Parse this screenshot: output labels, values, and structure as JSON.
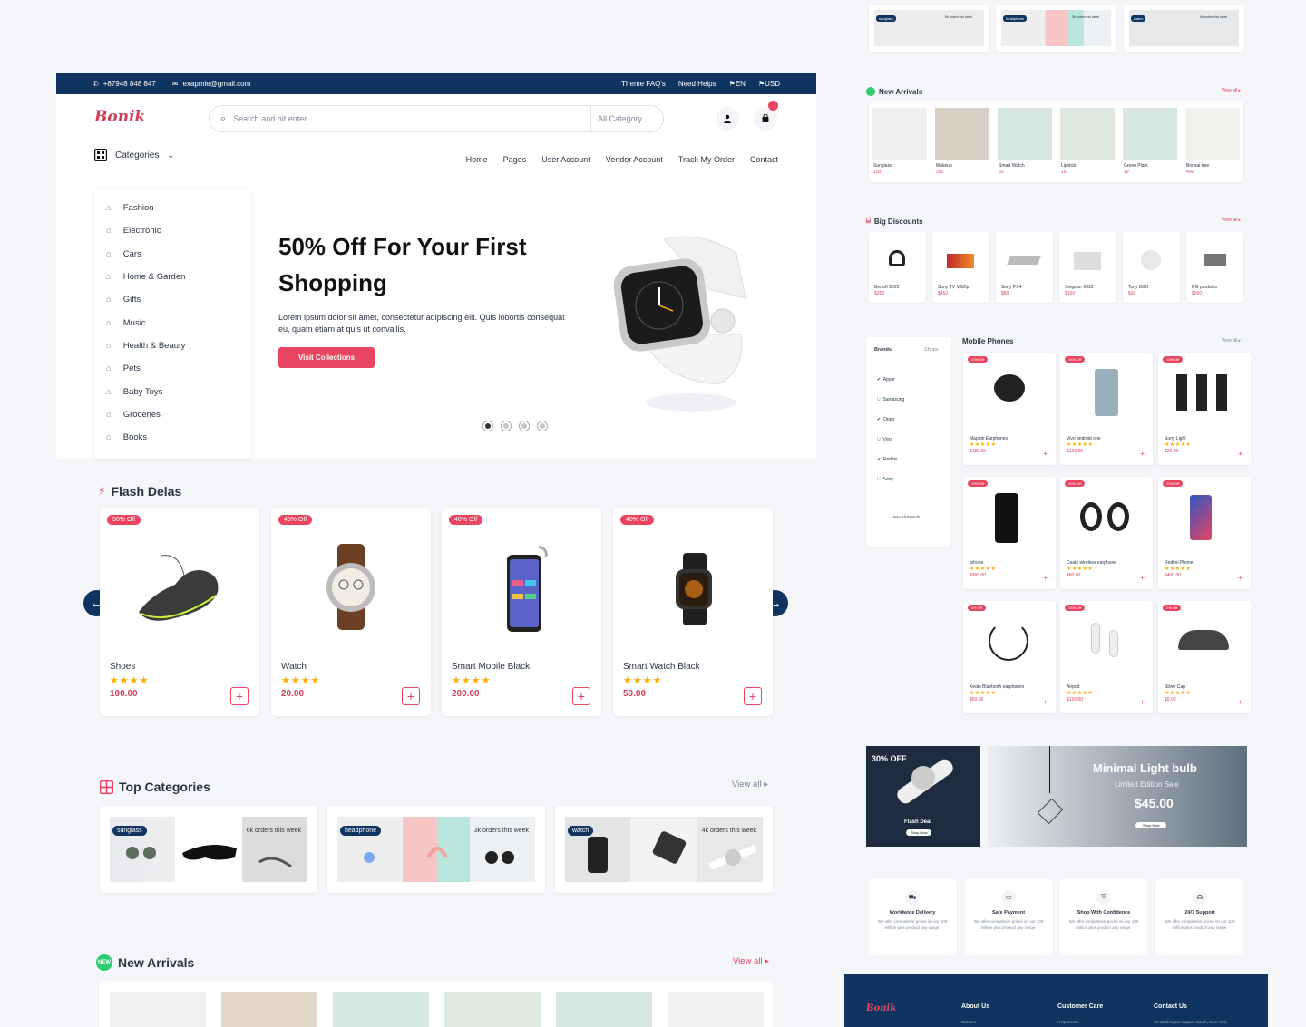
{
  "topbar": {
    "phone": "+87948 848 847",
    "email": "exapmle@gmail.com",
    "faq": "Theme FAQ's",
    "help": "Need Helps",
    "lang": "EN",
    "currency": "USD"
  },
  "header": {
    "logo": "Bonik",
    "search_placeholder": "Search and hit enter...",
    "category_select": "All Category",
    "categories_label": "Categories"
  },
  "nav": [
    "Home",
    "Pages",
    "User Account",
    "Vendor Account",
    "Track My Order",
    "Contact"
  ],
  "categories": [
    "Fashion",
    "Electronic",
    "Cars",
    "Home & Garden",
    "Gifts",
    "Music",
    "Health & Beauty",
    "Pets",
    "Baby Toys",
    "Groceries",
    "Books"
  ],
  "hero": {
    "title": "50% Off For Your First Shopping",
    "text": "Lorem ipsum dolor sit amet, consectetur adipiscing elit. Quis lobortis consequat eu, quam etiam at quis ut convallis.",
    "button": "Visit Collections",
    "slides": 4,
    "active_slide": 1
  },
  "flash": {
    "title": "Flash Delas",
    "items": [
      {
        "off": "50% Off",
        "name": "Shoes",
        "price": "100.00",
        "stars": "★★★★"
      },
      {
        "off": "40% Off",
        "name": "Watch",
        "price": "20.00",
        "stars": "★★★★"
      },
      {
        "off": "40% Off",
        "name": "Smart Mobile Black",
        "price": "200.00",
        "stars": "★★★★"
      },
      {
        "off": "40% Off",
        "name": "Smart Watch Black",
        "price": "50.00",
        "stars": "★★★★"
      }
    ]
  },
  "top_categories": {
    "title": "Top Categories",
    "view_all": "View all",
    "items": [
      {
        "tag": "sunglass",
        "orders": "6k orders this week"
      },
      {
        "tag": "headphone",
        "orders": "3k orders this week"
      },
      {
        "tag": "watch",
        "orders": "4k orders this week"
      }
    ]
  },
  "new_arrivals": {
    "title": "New Arrivals",
    "view_all": "View all",
    "badge": "NEW"
  },
  "right": {
    "top_strip": [
      {
        "tag": "sunglass",
        "orders": "6k orders this week"
      },
      {
        "tag": "headphone",
        "orders": "3k orders this week"
      },
      {
        "tag": "watch",
        "orders": "4k orders this week"
      }
    ],
    "new_arrivals": {
      "title": "New Arrivals",
      "view_all": "View all",
      "items": [
        {
          "name": "Sunglass",
          "price": "150"
        },
        {
          "name": "Makeup",
          "price": "250"
        },
        {
          "name": "Smart Watch",
          "price": "50"
        },
        {
          "name": "Lipstick",
          "price": "15"
        },
        {
          "name": "Green Plant",
          "price": "10"
        },
        {
          "name": "Bonsai tree",
          "price": "400"
        }
      ]
    },
    "big_discounts": {
      "title": "Big Discounts",
      "view_all": "View all",
      "items": [
        {
          "name": "BenuX 2022",
          "price": "$250"
        },
        {
          "name": "Sony TV 1080p",
          "price": "$450"
        },
        {
          "name": "Sony PS4",
          "price": "$50"
        },
        {
          "name": "Setgearr 2022",
          "price": "$100"
        },
        {
          "name": "Tony BGB",
          "price": "$20"
        },
        {
          "name": "RG products",
          "price": "$200"
        }
      ]
    },
    "brands": {
      "tab1": "Brands",
      "tab2": "Shops",
      "items": [
        "Apple",
        "Samasung",
        "Oppo",
        "Vivo",
        "Redimi",
        "Sony"
      ],
      "view_all": "View All Brands"
    },
    "mobile": {
      "title": "Mobile Phones",
      "view_all": "View all",
      "items": [
        {
          "off": "25% Off",
          "name": "Mapple Earphones",
          "price": "$180.00"
        },
        {
          "off": "15% Off",
          "name": "Vivo android one",
          "price": "$120.00"
        },
        {
          "off": "10% Off",
          "name": "Sony Light",
          "price": "$20.00"
        },
        {
          "off": "15% Off",
          "name": "Iphone",
          "price": "$999.00"
        },
        {
          "off": "15% Off",
          "name": "Ceats wireless earphone",
          "price": "$80.00"
        },
        {
          "off": "25% Off",
          "name": "Redimi Phone",
          "price": "$400.00"
        },
        {
          "off": "5% Off",
          "name": "Xeats Bluetooth earphones",
          "price": "$50.00"
        },
        {
          "off": "15% Off",
          "name": "Airpod",
          "price": "$120.00"
        },
        {
          "off": "2% Off",
          "name": "Silver Cap",
          "price": "$5.00"
        }
      ]
    },
    "promo1": {
      "off": "30% OFF",
      "label": "Flash Deal",
      "btn": "Shop Now"
    },
    "promo2": {
      "title": "Minimal  Light bulb",
      "sub": "Limited Edition Sale",
      "price": "$45.00",
      "btn": "Shop Now"
    },
    "services": [
      {
        "title": "Worldwide Delivery",
        "desc": "We offer competitive prices on our 100 million plus product any range."
      },
      {
        "title": "Safe Payment",
        "desc": "We offer competitive prices on our 100 million plus product any range."
      },
      {
        "title": "Shop With Confidence",
        "desc": "We offer competitive prices on our 100 million plus product any range."
      },
      {
        "title": "24/7 Support",
        "desc": "We offer competitive prices on our 100 million plus product any range."
      }
    ],
    "footer": {
      "logo": "Bonik",
      "col1": "About Us",
      "col1_sub": "Careers",
      "col2": "Customer Care",
      "col2_sub": "Help Center",
      "col3": "Contact Us",
      "col3_sub": "70 Washington Square South, New York,"
    }
  },
  "colors": {
    "primary": "#0f3460",
    "accent": "#e94560",
    "price": "#d23f57",
    "star": "#faaf00"
  }
}
